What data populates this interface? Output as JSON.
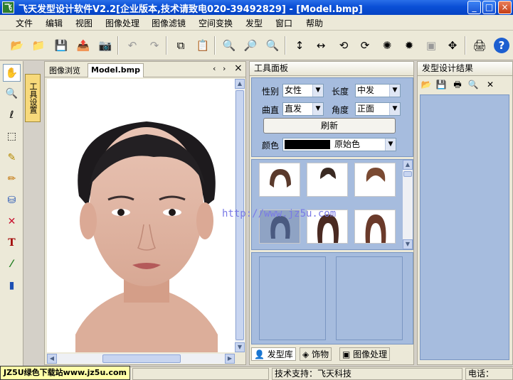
{
  "window": {
    "app_icon_text": "飞",
    "title": "飞天发型设计软件V2.2[企业版本,技术请致电020-39492829] - [Model.bmp]",
    "min": "_",
    "max": "□",
    "close": "×"
  },
  "menu": [
    "文件",
    "编辑",
    "视图",
    "图像处理",
    "图像滤镜",
    "空间变换",
    "发型",
    "窗口",
    "帮助"
  ],
  "toolbar": {
    "icons": [
      "open-folder-icon",
      "open-file-icon",
      "save-icon",
      "export-icon",
      "camera-icon",
      "undo-icon",
      "redo-icon",
      "copy-icon",
      "paste-icon",
      "zoom-in-icon",
      "zoom-tool-icon",
      "zoom-out-icon",
      "flip-vertical-icon",
      "flip-horizontal-icon",
      "rotate-left-icon",
      "rotate-right-icon",
      "brightness-icon",
      "contrast-icon",
      "crop-icon",
      "move-icon",
      "print-icon",
      "help-icon"
    ],
    "glyphs": [
      "📂",
      "📁",
      "💾",
      "📤",
      "📷",
      "↶",
      "↷",
      "⧉",
      "📋",
      "🔍",
      "🔎",
      "🔍",
      "↕",
      "↔",
      "⟲",
      "⟳",
      "✺",
      "✹",
      "▣",
      "✥",
      "🖨",
      "?"
    ]
  },
  "left_tools": {
    "icons": [
      "hand-icon",
      "zoom-icon",
      "lasso-icon",
      "marquee-icon",
      "brush-icon",
      "pencil-icon",
      "fill-icon",
      "eraser-icon",
      "text-icon",
      "eyedropper-icon",
      "chart-icon"
    ],
    "glyphs": [
      "✋",
      "🔍",
      "ℓ",
      "⬚",
      "✎",
      "✏",
      "⛁",
      "✕",
      "T",
      "⁄",
      "▮"
    ],
    "vertical_tab": "工具设置"
  },
  "document": {
    "tabs": [
      "图像浏览",
      "Model.bmp"
    ],
    "nav_prev": "‹",
    "nav_next": "›",
    "close": "×"
  },
  "watermark": "http://www.jz5u.com",
  "tool_panel": {
    "title": "工具面板",
    "gender_label": "性别",
    "gender_value": "女性",
    "length_label": "长度",
    "length_value": "中发",
    "curl_label": "曲直",
    "curl_value": "直发",
    "angle_label": "角度",
    "angle_value": "正面",
    "refresh_label": "刷新",
    "color_label": "颜色",
    "color_value": "原始色",
    "color_swatch": "#000000",
    "tabs": [
      "发型库",
      "饰物",
      "图像处理"
    ]
  },
  "result_panel": {
    "title": "发型设计结果",
    "icons": [
      "open-icon",
      "save-icon",
      "print-icon",
      "preview-icon",
      "delete-icon"
    ],
    "glyphs": [
      "📂",
      "💾",
      "🖶",
      "🔍",
      "✕"
    ]
  },
  "status": {
    "left": "",
    "support": "技术支持：飞天科技",
    "phone": "电话："
  },
  "badge": "JZ5U绿色下载站www.jz5u.com",
  "colors": {
    "titlebar": "#0a4fd6",
    "panel_blue": "#a6bcde",
    "chrome": "#ece9d8"
  }
}
